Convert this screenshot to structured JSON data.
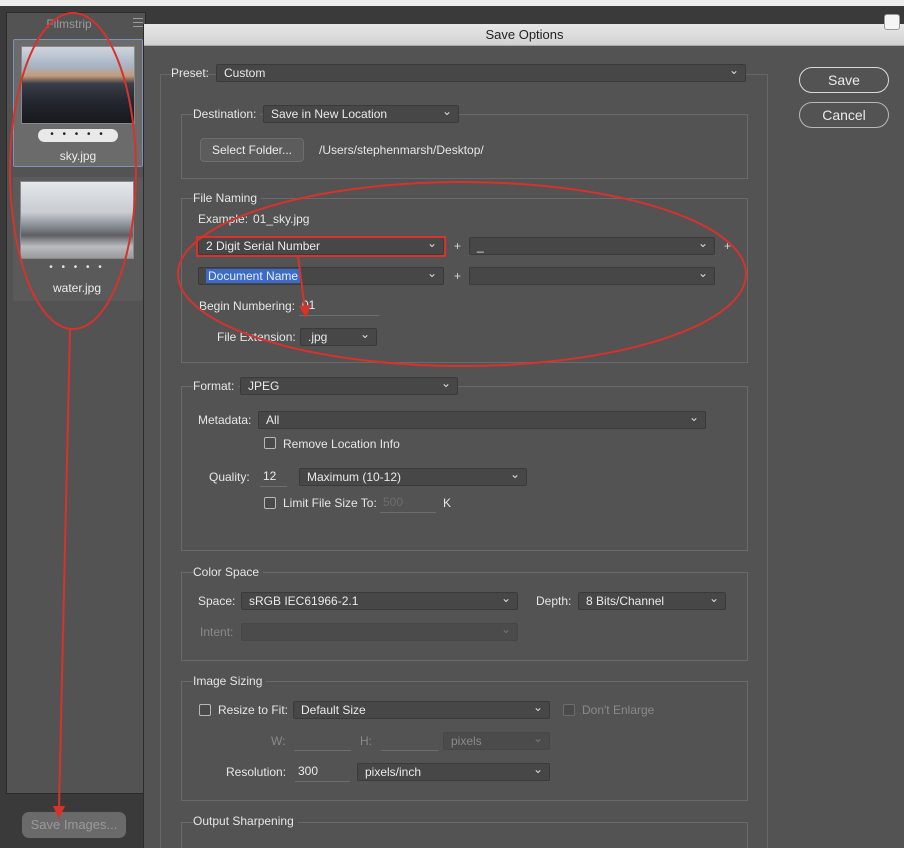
{
  "filmstrip": {
    "title": "Filmstrip",
    "items": [
      {
        "name": "sky.jpg",
        "rating": "• • • • •",
        "selected": true
      },
      {
        "name": "water.jpg",
        "rating": "• • • • •",
        "selected": false
      }
    ],
    "save_images_label": "Save Images..."
  },
  "dialog": {
    "title": "Save Options",
    "preset_label": "Preset:",
    "preset_value": "Custom",
    "save_label": "Save",
    "cancel_label": "Cancel",
    "destination": {
      "label": "Destination:",
      "value": "Save in New Location",
      "select_folder_label": "Select Folder...",
      "path": "/Users/stephenmarsh/Desktop/"
    },
    "file_naming": {
      "title": "File Naming",
      "example_label": "Example:",
      "example_value": "01_sky.jpg",
      "field1": "2 Digit Serial Number",
      "field2": "_",
      "field3": "Document Name",
      "field4": "",
      "plus": "+",
      "begin_numbering_label": "Begin Numbering:",
      "begin_numbering_value": "01",
      "file_extension_label": "File Extension:",
      "file_extension_value": ".jpg"
    },
    "format": {
      "label": "Format:",
      "value": "JPEG",
      "metadata_label": "Metadata:",
      "metadata_value": "All",
      "remove_location_label": "Remove Location Info",
      "quality_label": "Quality:",
      "quality_value": "12",
      "quality_preset": "Maximum  (10-12)",
      "limit_size_label": "Limit File Size To:",
      "limit_size_value": "500",
      "limit_size_unit": "K"
    },
    "color_space": {
      "title": "Color Space",
      "space_label": "Space:",
      "space_value": "sRGB IEC61966-2.1",
      "depth_label": "Depth:",
      "depth_value": "8 Bits/Channel",
      "intent_label": "Intent:",
      "intent_value": ""
    },
    "image_sizing": {
      "title": "Image Sizing",
      "resize_label": "Resize to Fit:",
      "resize_value": "Default Size",
      "dont_enlarge_label": "Don't Enlarge",
      "w_label": "W:",
      "h_label": "H:",
      "units_value": "pixels",
      "resolution_label": "Resolution:",
      "resolution_value": "300",
      "resolution_units": "pixels/inch"
    },
    "output_sharpening": {
      "title": "Output Sharpening"
    }
  },
  "colors": {
    "annotation_red": "#d7322b",
    "selection_blue": "#3b6bc9"
  }
}
